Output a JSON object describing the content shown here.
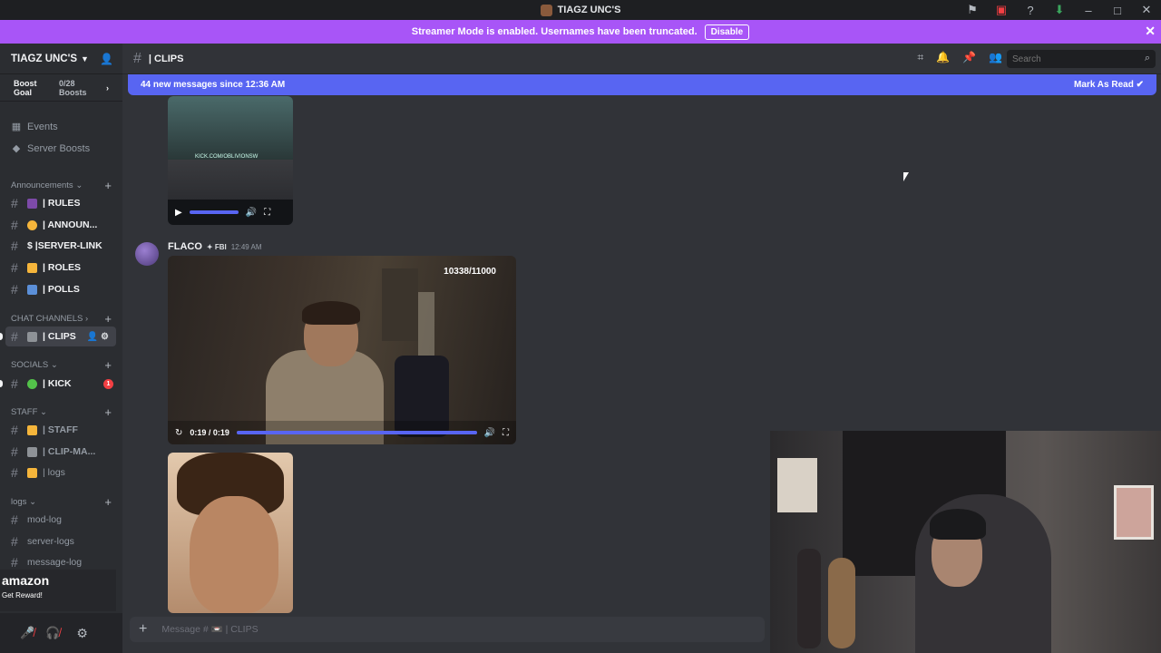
{
  "window": {
    "title": "TIAGZ UNC'S"
  },
  "banner": {
    "text": "Streamer Mode is enabled. Usernames have been truncated.",
    "button": "Disable"
  },
  "server": {
    "name": "TIAGZ UNC'S",
    "boost_goal": "Boost Goal",
    "boost_count": "0/28 Boosts"
  },
  "sidebar": {
    "top_items": [
      {
        "label": "Events"
      },
      {
        "label": "Server Boosts"
      }
    ],
    "categories": {
      "announcements": "Announcements",
      "chat": "CHAT CHANNELS",
      "socials": "SOCIALS",
      "staff": "STAFF",
      "logs": "logs"
    },
    "channels": {
      "rules": "| RULES",
      "announ": "| ANNOUN...",
      "server_link": "$ |SERVER-LINK",
      "roles": "| ROLES",
      "polls": "| POLLS",
      "clips": "| CLIPS",
      "kick": "| KICK",
      "kick_badge": "1",
      "staff": "| STAFF",
      "clip_ma": "| CLIP-MA...",
      "logs": "| logs",
      "mod_log": "mod-log",
      "server_logs": "server-logs",
      "message_log": "message-log"
    }
  },
  "amazon": {
    "logo": "amazon",
    "reward": "Get Reward!"
  },
  "channel_header": {
    "name": "| CLIPS",
    "search_placeholder": "Search"
  },
  "new_messages": {
    "text": "44 new messages since 12:36 AM",
    "mark": "Mark As Read"
  },
  "video1": {
    "watermark": "KICK.COM/OBLIVIONSW"
  },
  "message": {
    "author": "FLACO",
    "tag": "FBI",
    "time": "12:49 AM",
    "video": {
      "counter": "10338/11000",
      "time": "0:19 / 0:19",
      "progress": 1.0
    }
  },
  "composer": {
    "placeholder": "Message # 📼 | CLIPS"
  },
  "colors": {
    "accent": "#5865f2",
    "banner": "#a855f7",
    "danger": "#f23f43"
  }
}
